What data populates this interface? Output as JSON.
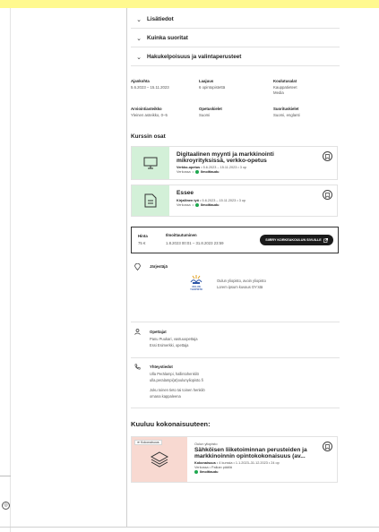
{
  "accordion": [
    {
      "label": "Lisätiedot"
    },
    {
      "label": "Kuinka suoritat"
    },
    {
      "label": "Hakukelpoisuus ja valintaperusteet"
    }
  ],
  "details": {
    "ajankohta": {
      "label": "Ajankohta",
      "value": "5.6.2023 – 15.11.2023"
    },
    "laajuus": {
      "label": "Laajuus",
      "value": "6 opintopistettä"
    },
    "koulutusala": {
      "label": "Koulutusalat",
      "value": "Kauppatieteet\nMedia"
    },
    "arviointiasteikko": {
      "label": "Arviointiasteikko",
      "value": "Yleinen asteikko, 0–5"
    },
    "opetuskielet": {
      "label": "Opetuskielet",
      "value": "Suomi"
    },
    "suorituskielet": {
      "label": "Suorituskielet",
      "value": "Suomi, englanti"
    }
  },
  "course_parts": {
    "heading": "Kurssin osat",
    "items": [
      {
        "title": "Digitaalinen myynti ja markkinointi mikroyrityksissä, verkko-opetus",
        "meta_label": "Verkko-opetus",
        "meta_rest": " • 5.6.2023 – 15.11.2023 • 3 op",
        "mode": "Verkossa",
        "status": "Ilmoittaudu"
      },
      {
        "title": "Essee",
        "meta_label": "Kirjallinen työ",
        "meta_rest": " • 5.6.2023 – 15.11.2023 • 3 op",
        "mode": "Verkossa",
        "status": "Ilmoittaudu"
      }
    ]
  },
  "price_box": {
    "price_label": "Hinta",
    "price_value": "75 €",
    "enroll_label": "Ilmoittautuminen",
    "enroll_value": "1.8.2023 00:01 – 31.8.2023 23:59",
    "cta_label": "SIIRRY KORKEAKOULUN SIVUILLE"
  },
  "organizer": {
    "title": "Järjestäjä",
    "logo_text": "OULUN\nYLIOPISTO",
    "name": "Oulun yliopisto, avoin yliopisto",
    "desc": "Lorem ipsum kuvaus OY:stä"
  },
  "teachers": {
    "title": "Opettajat",
    "lines": [
      "Panu Puukari, vastuuopettaja",
      "Essi Esimerkki, opettaja"
    ]
  },
  "contacts": {
    "title": "Yhteystiedot",
    "lines": [
      "Ulla Perälampi, hallintohenkilö",
      "ulla.peralampi(at)oulunyliopisto.fi",
      "Joku toinen tieto tai toinen henkilö",
      "omana kappaleena"
    ]
  },
  "whole": {
    "heading": "Kuuluu kokonaisuuteen:",
    "badge": "Kokonaisuus",
    "provider": "Oulun yliopisto",
    "title": "Sähköisen liiketoiminnan perusteiden ja markkinoinnin opintokokonaisuus (av...",
    "meta_label": "Kokonaisuus",
    "meta_rest": " • 4 kurssia • 1.1.2023–31.12.2023 • 24 op",
    "mode": "Verkossa • Paikan päällä",
    "status": "Ilmoittaudu"
  },
  "colors": {
    "topbar": "#fff98f",
    "card_thumb_green": "#d3f0d8",
    "whole_thumb_pink": "#f8d9d1",
    "status_green": "#1ea84f",
    "cta_bg": "#1b1b1b"
  },
  "left_button_icon": "help-icon"
}
